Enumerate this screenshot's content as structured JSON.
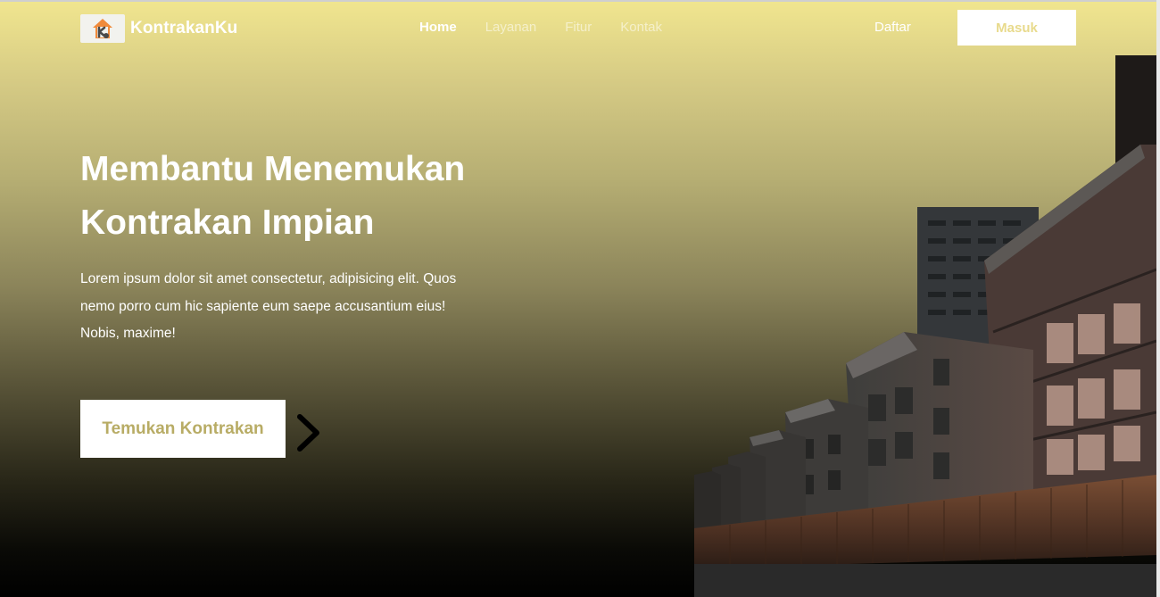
{
  "brand": {
    "name": "KontrakanKu",
    "logo_icon": "house-key-logo-icon"
  },
  "nav": {
    "links": [
      {
        "label": "Home",
        "active": true
      },
      {
        "label": "Layanan",
        "active": false
      },
      {
        "label": "Fitur",
        "active": false
      },
      {
        "label": "Kontak",
        "active": false
      }
    ],
    "register_label": "Daftar",
    "login_label": "Masuk"
  },
  "hero": {
    "title_line1": "Membantu Menemukan",
    "title_line2": "Kontrakan Impian",
    "description": "Lorem ipsum dolor sit amet consectetur, adipisicing elit. Quos nemo porro cum hic sapiente eum saepe accusantium eius! Nobis, maxime!",
    "cta_label": "Temukan Kontrakan",
    "cta_icon": "chevron-right-icon",
    "image_icon": "apartment-buildings-photo"
  },
  "colors": {
    "gradient_top": "#f1e68f",
    "gradient_bottom": "#000000",
    "accent_text": "#b8ac65",
    "login_text": "#e8da8c"
  }
}
